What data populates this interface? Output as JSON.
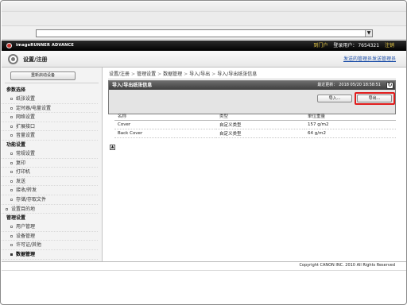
{
  "browser": {
    "address_value": "",
    "dropdown_glyph": "▼"
  },
  "header": {
    "brand": "imageRUNNER ADVANCE",
    "portal_link": "到门户",
    "login_user_label": "登录用户：",
    "login_user_value": "7654321",
    "logout_link": "注销"
  },
  "subheader": {
    "title": "设置/注册",
    "send_link": "发送的管理员发送管理员"
  },
  "sidebar": {
    "menu_button": "重新启动设备",
    "groups": [
      {
        "title": "参数选择",
        "items": [
          "纸张设置",
          "定时器/电量设置",
          "网络设置",
          "扩展接口",
          "音量设置"
        ]
      },
      {
        "title": "功能设置",
        "items": [
          "常规设置",
          "复印",
          "打印机",
          "发送",
          "接收/转发",
          "存储/存取文件"
        ]
      },
      {
        "title": "",
        "items": [
          "设置目的地"
        ]
      },
      {
        "title": "管理设置",
        "items": [
          "用户管理",
          "设备管理",
          "许可证/其他",
          "数据管理"
        ]
      }
    ]
  },
  "breadcrumb": [
    "设置/注册",
    "管理设置",
    "数据管理",
    "导入/导出",
    "导入/导出纸张信息"
  ],
  "panel": {
    "title": "导入/导出纸张信息",
    "updated_label": "最近更新：",
    "updated_value": "2018 05/20 18:58:51",
    "import_button": "导入...",
    "export_button": "导出..."
  },
  "table": {
    "headers": [
      "名称",
      "类型",
      "单位重量"
    ],
    "rows": [
      [
        "Cover",
        "自定义类型",
        "157 g/m2"
      ],
      [
        "Back Cover",
        "自定义类型",
        "64 g/m2"
      ]
    ]
  },
  "footer": {
    "copyright": "Copyright CANON INC. 2010 All Rights Reserved"
  },
  "colors": {
    "highlight": "#e01b1b",
    "header_bg": "#000000",
    "link_yellow": "#f2d34a",
    "link_blue": "#1d4fa8"
  }
}
